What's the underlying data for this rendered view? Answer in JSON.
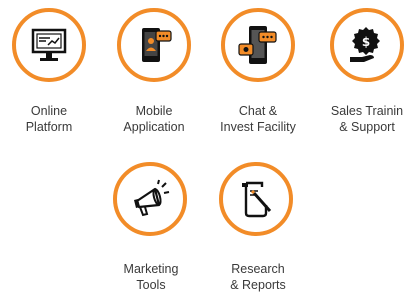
{
  "accent_color": "#f28c28",
  "features": [
    {
      "id": "online-platform",
      "icon": "monitor-icon",
      "lines": [
        "Online",
        "Platform"
      ]
    },
    {
      "id": "mobile-application",
      "icon": "smartphone-icon",
      "lines": [
        "Mobile",
        "Application"
      ]
    },
    {
      "id": "chat-invest",
      "icon": "chat-phone-icon",
      "lines": [
        "Chat &",
        "Invest Facility"
      ]
    },
    {
      "id": "sales-training",
      "icon": "hand-dollar-icon",
      "lines": [
        "Sales Trainin",
        "& Support"
      ]
    },
    {
      "id": "marketing-tools",
      "icon": "megaphone-icon",
      "lines": [
        "Marketing",
        "Tools"
      ]
    },
    {
      "id": "research-reports",
      "icon": "document-pen-icon",
      "lines": [
        "Research",
        "& Reports"
      ]
    }
  ]
}
